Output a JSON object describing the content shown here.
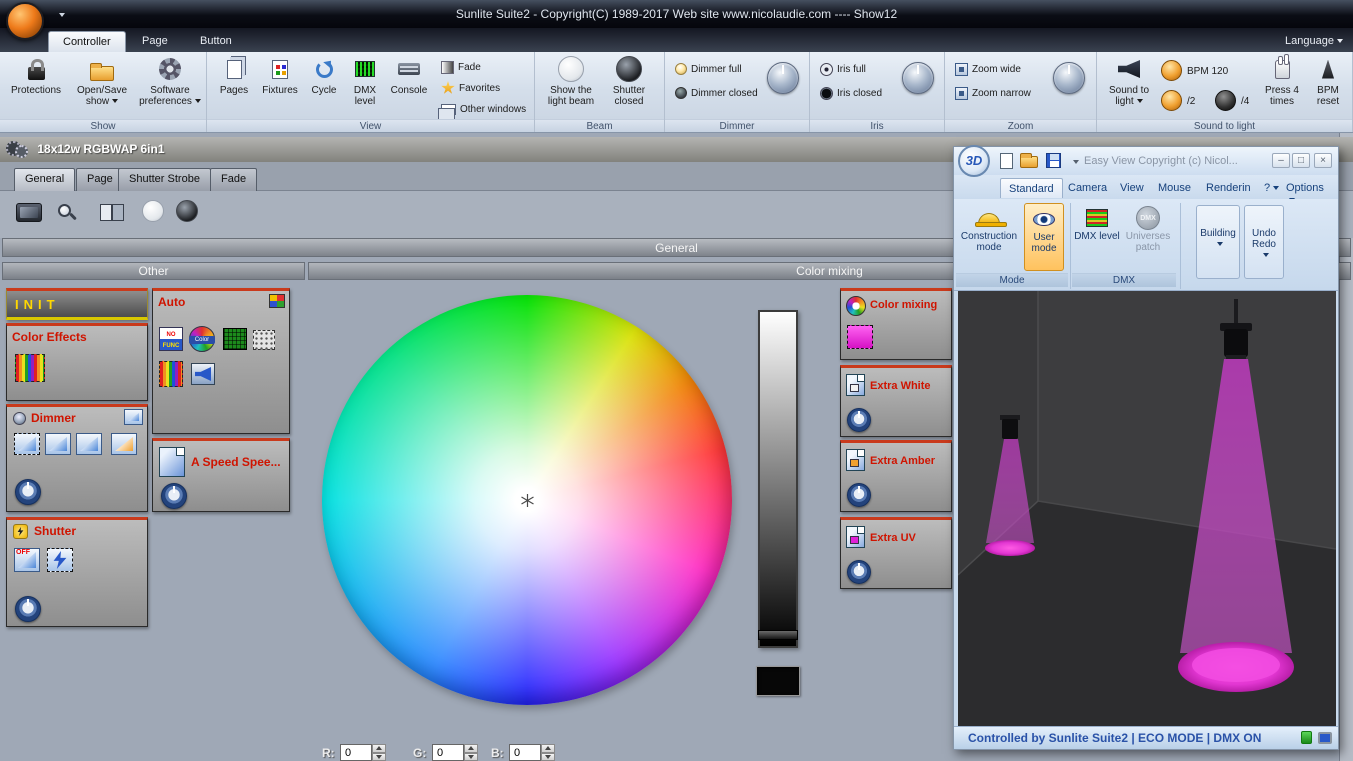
{
  "app": {
    "title": "Sunlite Suite2 - Copyright(C) 1989-2017    Web site www.nicolaudie.com ---- Show12",
    "language": "Language"
  },
  "ribbon_tabs": {
    "controller": "Controller",
    "page": "Page",
    "button": "Button"
  },
  "show_group": {
    "label": "Show",
    "protections": "Protections",
    "open_save": "Open/Save show",
    "prefs": "Software preferences"
  },
  "view_group": {
    "label": "View",
    "pages": "Pages",
    "fixtures": "Fixtures",
    "cycle": "Cycle",
    "dmx": "DMX level",
    "console": "Console",
    "fade": "Fade",
    "favorites": "Favorites",
    "other_windows": "Other windows"
  },
  "beam_group": {
    "label": "Beam",
    "show_beam": "Show the light beam",
    "shutter_closed": "Shutter closed"
  },
  "dimmer_group": {
    "label": "Dimmer",
    "full": "Dimmer full",
    "closed": "Dimmer closed"
  },
  "iris_group": {
    "label": "Iris",
    "full": "Iris full",
    "closed": "Iris closed"
  },
  "zoom_group": {
    "label": "Zoom",
    "wide": "Zoom wide",
    "narrow": "Zoom narrow"
  },
  "sound_group": {
    "label": "Sound to light",
    "button": "Sound to light",
    "bpm": "BPM 120",
    "div2": "/2",
    "div4": "/4",
    "press": "Press 4 times",
    "reset": "BPM reset"
  },
  "fixture": {
    "title": "18x12w RGBWAP 6in1",
    "tabs": {
      "general": "General",
      "page": "Page",
      "shutter": "Shutter Strobe",
      "fade": "Fade"
    },
    "header": "General"
  },
  "other_panel": {
    "title": "Other",
    "init": "INIT",
    "color_effects": "Color Effects",
    "dimmer": "Dimmer",
    "shutter": "Shutter",
    "off": "OFF"
  },
  "auto_panel": {
    "title": "Auto",
    "no": "NO",
    "func": "FUNC",
    "color": "Color",
    "speed": "A Speed Spee..."
  },
  "mixing_panel": {
    "title": "Color mixing",
    "color_mixing": "Color mixing",
    "extra_white": "Extra White",
    "extra_amber": "Extra Amber",
    "extra_uv": "Extra UV"
  },
  "rgb": {
    "r_label": "R:",
    "g_label": "G:",
    "b_label": "B:",
    "r": "0",
    "g": "0",
    "b": "0"
  },
  "easy_view": {
    "logo": "3D",
    "title": "Easy View   Copyright (c) Nicol...",
    "menu": {
      "standard": "Standard",
      "camera": "Camera",
      "view": "View",
      "mouse": "Mouse",
      "rendering": "Renderin",
      "help": "?",
      "options": "Options"
    },
    "construction": "Construction mode",
    "user_mode": "User mode",
    "mode": "Mode",
    "dmx_level": "DMX level",
    "universes": "Universes patch",
    "dmx": "DMX",
    "dmx_badge": "DMX",
    "building": "Building",
    "undo_redo": "Undo Redo",
    "status": "Controlled by Sunlite Suite2   |   ECO MODE   |   DMX ON",
    "win": {
      "min": "–",
      "max": "□",
      "close": "×"
    }
  }
}
